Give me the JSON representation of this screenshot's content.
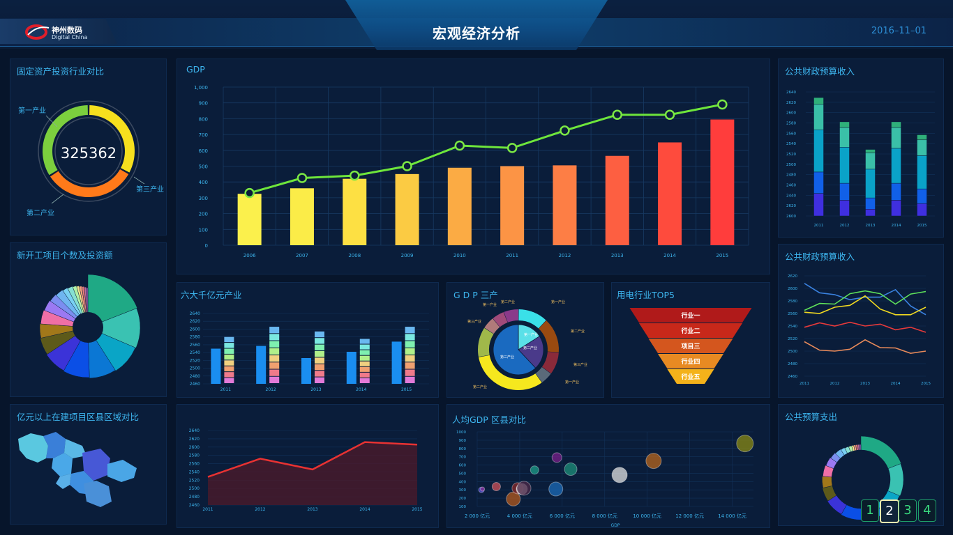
{
  "header": {
    "title": "宏观经济分析",
    "date": "2016–11–01",
    "logo_cn": "神州数码",
    "logo_en": "Digital China"
  },
  "panels": {
    "fixed_asset": {
      "title": "固定资产投资行业对比",
      "total": "325362",
      "labels": [
        "第一产业",
        "第二产业",
        "第三产业"
      ]
    },
    "gdp": {
      "title": "GDP"
    },
    "budget_revenue_1": {
      "title": "公共财政预算收入"
    },
    "new_projects": {
      "title": "新开工项目个数及投资额"
    },
    "six_industries": {
      "title": "六大千亿元产业"
    },
    "gdp_three": {
      "title": "G D P 三产"
    },
    "power_top5": {
      "title": "用电行业TOP5"
    },
    "budget_revenue_2": {
      "title": "公共财政预算收入"
    },
    "projects_region": {
      "title": "亿元以上在建项目区县区域对比"
    },
    "per_capita_gdp": {
      "title": "人均GDP 区县对比",
      "x_axis_label": "GDP"
    },
    "budget_expense": {
      "title": "公共预算支出"
    }
  },
  "pager": {
    "pages": [
      "1",
      "2",
      "3",
      "4"
    ],
    "active": "2"
  },
  "colors": {
    "accent": "#3db5ee",
    "line_green": "#6ee63b",
    "bg": "#07152b"
  },
  "chart_data": [
    {
      "id": "gdp",
      "type": "bar",
      "title": "GDP",
      "categories": [
        "2006",
        "2007",
        "2008",
        "2009",
        "2010",
        "2011",
        "2012",
        "2013",
        "2014",
        "2015"
      ],
      "series": [
        {
          "values": [
            325,
            360,
            420,
            450,
            490,
            500,
            505,
            565,
            650,
            795
          ]
        },
        {
          "type": "line",
          "values": [
            330,
            425,
            440,
            500,
            630,
            615,
            725,
            825,
            825,
            890
          ]
        }
      ],
      "ylim": [
        0,
        1000
      ],
      "yticks": [
        0,
        100,
        200,
        300,
        400,
        500,
        600,
        700,
        800,
        900,
        "1,000"
      ],
      "grid": true
    },
    {
      "id": "budget_revenue_1",
      "type": "bar",
      "categories": [
        "2011",
        "2012",
        "2013",
        "2014",
        "2015"
      ],
      "series": [
        {
          "values": [
            2470,
            2458,
            2442,
            2458,
            2452
          ]
        },
        {
          "values": [
            2508,
            2488,
            2462,
            2488,
            2478
          ]
        },
        {
          "values": [
            2583,
            2552,
            2513,
            2550,
            2537
          ]
        },
        {
          "values": [
            2628,
            2587,
            2542,
            2587,
            2565
          ]
        },
        {
          "values": [
            2640,
            2597,
            2548,
            2597,
            2574
          ]
        }
      ],
      "ylim": [
        2600,
        2640
      ],
      "yticks": [
        "2600",
        "2620",
        "2440",
        "2460",
        "2480",
        "2500",
        "2520",
        "2540",
        "2560",
        "2580",
        "2600",
        "2620",
        "2640"
      ]
    },
    {
      "id": "new_projects",
      "type": "pie",
      "values": [
        20,
        13,
        10,
        9,
        9,
        8,
        6,
        5,
        5,
        4,
        3,
        3,
        2,
        2,
        1.5,
        1,
        1,
        1,
        0.8,
        0.7
      ]
    },
    {
      "id": "fixed_asset",
      "type": "pie",
      "categories": [
        "第一产业",
        "第三产业",
        "第二产业"
      ],
      "values": [
        33,
        33,
        34
      ]
    },
    {
      "id": "six_industries",
      "type": "bar",
      "categories": [
        "2011",
        "2012",
        "2013",
        "2014",
        "2015"
      ],
      "series": [
        {
          "values": [
            2550,
            2557,
            2526,
            2542,
            2568
          ]
        },
        {
          "values": [
            2580,
            2606,
            2594,
            2575,
            2606
          ]
        }
      ],
      "ylim": [
        2460,
        2640
      ],
      "yticks": [
        2460,
        2480,
        2500,
        2520,
        2540,
        2560,
        2580,
        2600,
        2620,
        2640
      ]
    },
    {
      "id": "gdp_three",
      "type": "pie",
      "categories": [
        "第一产业",
        "第二产业",
        "第三产业"
      ],
      "values": [
        16,
        22,
        62
      ]
    },
    {
      "id": "power_top5",
      "type": "table",
      "categories": [
        "行业一",
        "行业二",
        "项目三",
        "行业四",
        "行业五"
      ]
    },
    {
      "id": "budget_revenue_2",
      "type": "line",
      "categories": [
        "2011",
        "2012",
        "2013",
        "2014",
        "2015"
      ],
      "series": [
        {
          "values": [
            2608,
            2590,
            2586,
            2598,
            2558
          ]
        },
        {
          "values": [
            2565,
            2575,
            2596,
            2575,
            2595
          ]
        },
        {
          "values": [
            2562,
            2570,
            2588,
            2558,
            2570
          ]
        },
        {
          "values": [
            2538,
            2540,
            2540,
            2534,
            2530
          ]
        },
        {
          "values": [
            2515,
            2500,
            2518,
            2505,
            2500
          ]
        }
      ],
      "ylim": [
        2460,
        2620
      ],
      "yticks": [
        2460,
        2480,
        2500,
        2520,
        2540,
        2560,
        2580,
        2600,
        2620
      ]
    },
    {
      "id": "bottom_area",
      "type": "area",
      "categories": [
        "2011",
        "2012",
        "2013",
        "2014",
        "2015"
      ],
      "values": [
        2528,
        2572,
        2546,
        2612,
        2606
      ],
      "ylim": [
        2460,
        2640
      ],
      "yticks": [
        2460,
        2480,
        2500,
        2520,
        2540,
        2560,
        2580,
        2600,
        2620,
        2640
      ]
    },
    {
      "id": "per_capita_gdp",
      "type": "scatter",
      "xlabel": "GDP",
      "xticks": [
        "2 000 亿元",
        "4 000 亿元",
        "6 000 亿元",
        "8 000 亿元",
        "10 000 亿元",
        "12 000 亿元",
        "14 000 亿元"
      ],
      "yticks": [
        100,
        200,
        300,
        400,
        500,
        600,
        700,
        800,
        900,
        1000
      ],
      "xlim": [
        2000,
        15000
      ],
      "ylim": [
        100,
        1000
      ],
      "points": [
        {
          "x": 2200,
          "y": 300,
          "size": 4,
          "color": "#5a4fd8"
        },
        {
          "x": 2250,
          "y": 310,
          "size": 3,
          "color": "#7d2b8a"
        },
        {
          "x": 2900,
          "y": 340,
          "size": 6,
          "color": "#d0525a"
        },
        {
          "x": 3700,
          "y": 190,
          "size": 10,
          "color": "#b45a1e"
        },
        {
          "x": 3900,
          "y": 320,
          "size": 8,
          "color": "#8a2a2a"
        },
        {
          "x": 4100,
          "y": 310,
          "size": 8,
          "color": "#e2e2e2"
        },
        {
          "x": 4200,
          "y": 320,
          "size": 10,
          "color": "#4d2a4a"
        },
        {
          "x": 4700,
          "y": 540,
          "size": 6,
          "color": "#1e9e8a"
        },
        {
          "x": 5700,
          "y": 310,
          "size": 10,
          "color": "#1c6bb8"
        },
        {
          "x": 5750,
          "y": 690,
          "size": 7,
          "color": "#7a1f8a"
        },
        {
          "x": 6400,
          "y": 550,
          "size": 9,
          "color": "#1e8f7a"
        },
        {
          "x": 8700,
          "y": 480,
          "size": 11,
          "color": "#e2e2e2"
        },
        {
          "x": 10300,
          "y": 650,
          "size": 11,
          "color": "#b8661c"
        },
        {
          "x": 14600,
          "y": 860,
          "size": 12,
          "color": "#8a8a14"
        }
      ],
      "grid": true
    },
    {
      "id": "budget_expense",
      "type": "pie",
      "values": [
        20,
        13,
        10,
        9,
        9,
        8,
        6,
        5,
        5,
        4,
        3,
        3,
        2,
        2,
        1.5,
        1,
        1,
        1,
        0.8,
        0.7
      ]
    }
  ]
}
